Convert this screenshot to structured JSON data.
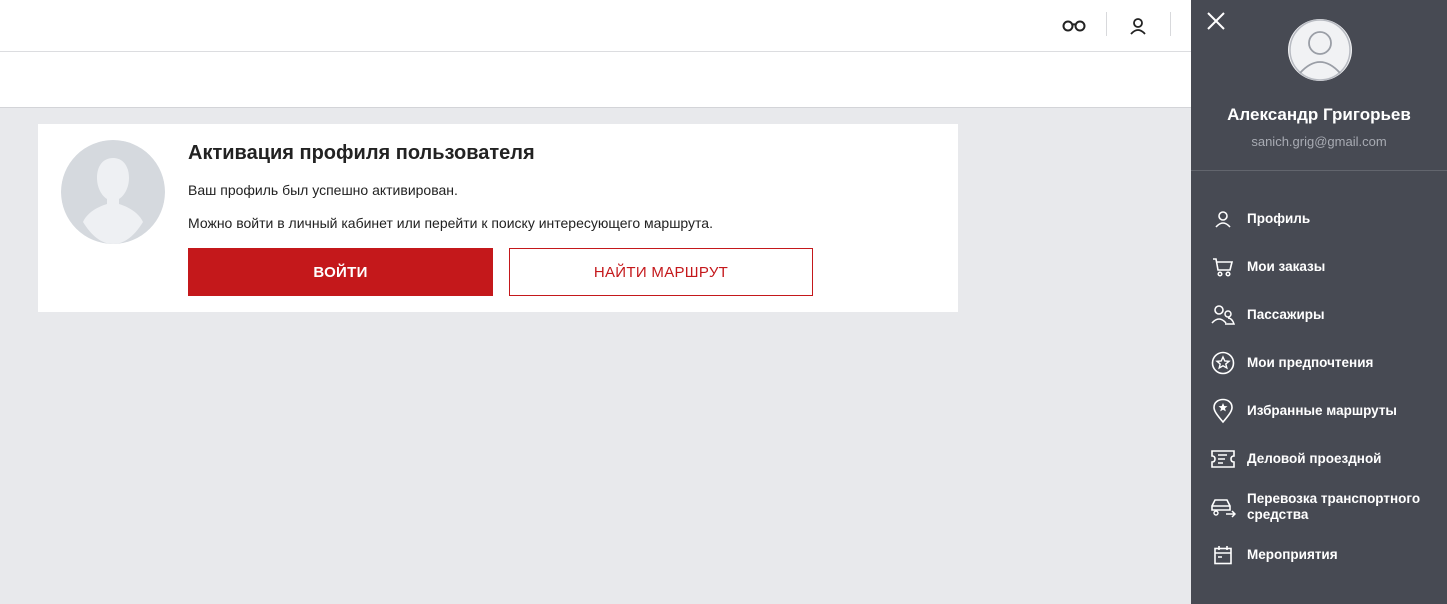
{
  "header": {
    "icons": [
      "glasses-icon",
      "user-icon"
    ]
  },
  "activation": {
    "title": "Активация профиля пользователя",
    "message1": "Ваш профиль был успешно активирован.",
    "message2": "Можно войти в личный кабинет или перейти к поиску интересующего маршрута.",
    "login_button": "ВОЙТИ",
    "find_route_button": "НАЙТИ МАРШРУТ"
  },
  "user_panel": {
    "name": "Александр Григорьев",
    "email": "sanich.grig@gmail.com",
    "menu": [
      {
        "label": "Профиль",
        "icon": "user-icon"
      },
      {
        "label": "Мои заказы",
        "icon": "cart-icon"
      },
      {
        "label": "Пассажиры",
        "icon": "passengers-icon"
      },
      {
        "label": "Мои предпочтения",
        "icon": "star-circle-icon"
      },
      {
        "label": "Избранные маршруты",
        "icon": "star-pin-icon"
      },
      {
        "label": "Деловой проездной",
        "icon": "ticket-icon"
      },
      {
        "label": "Перевозка транспортного средства",
        "icon": "car-icon"
      },
      {
        "label": "Мероприятия",
        "icon": "calendar-icon"
      }
    ]
  },
  "colors": {
    "accent": "#c4181b",
    "panel_bg": "#474a53",
    "page_bg": "#e8e9ec"
  }
}
